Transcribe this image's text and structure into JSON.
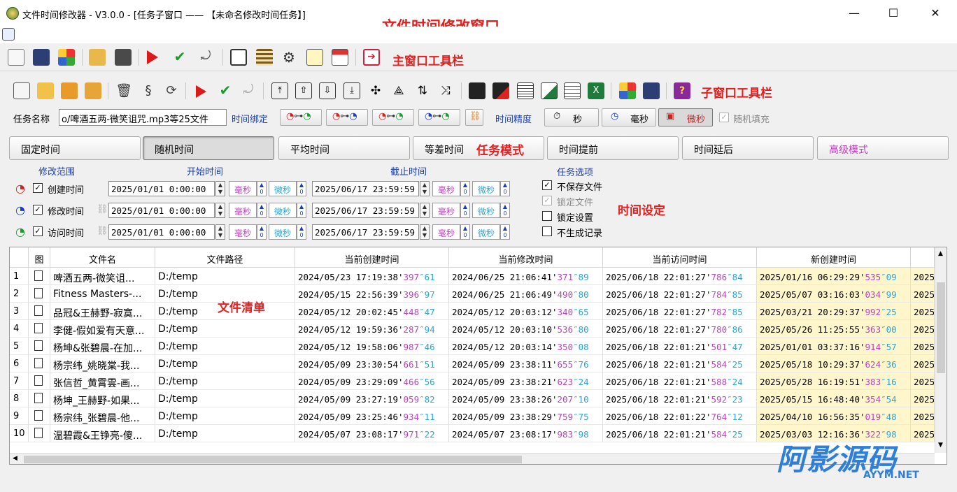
{
  "window": {
    "title": "文件时间修改器  - V3.0.0 - [任务子窗口 —— 【未命名修改时间任务】]",
    "minimize": "—",
    "maximize": "☐",
    "close": "✕"
  },
  "annotations": {
    "window": "文件时间修改窗口",
    "main_toolbar": "主窗口工具栏",
    "sub_toolbar": "子窗口工具栏",
    "task_mode": "任务模式",
    "time_setting": "时间设定",
    "file_list": "文件清单"
  },
  "task": {
    "name_label": "任务名称",
    "name_value": "o/啤酒五两-微笑诅咒.mp3等25文件",
    "bind_label": "时间绑定",
    "precision_label": "时间精度",
    "precision_options": [
      "秒",
      "毫秒",
      "微秒"
    ],
    "random_fill": "随机填充"
  },
  "modes": [
    "固定时间",
    "随机时间",
    "平均时间",
    "等差时间",
    "时间提前",
    "时间延后",
    "高级模式"
  ],
  "time_settings": {
    "range_label": "修改范围",
    "start_label": "开始时间",
    "end_label": "截止时间",
    "ms_label": "毫秒",
    "us_label": "微秒",
    "zero": "0",
    "rows": [
      {
        "label": "创建时间",
        "start": "2025/01/01  0:00:00",
        "end": "2025/06/17  23:59:59"
      },
      {
        "label": "修改时间",
        "start": "2025/01/01  0:00:00",
        "end": "2025/06/17  23:59:59"
      },
      {
        "label": "访问时间",
        "start": "2025/01/01  0:00:00",
        "end": "2025/06/17  23:59:59"
      }
    ],
    "options_label": "任务选项",
    "options": [
      {
        "label": "不保存文件",
        "checked": true
      },
      {
        "label": "锁定文件",
        "checked": true
      },
      {
        "label": "锁定设置",
        "checked": false
      },
      {
        "label": "不生成记录",
        "checked": false
      }
    ]
  },
  "grid": {
    "columns": [
      "图",
      "文件名",
      "文件路径",
      "当前创建时间",
      "当前修改时间",
      "当前访问时间",
      "新创建时间"
    ],
    "rows": [
      {
        "n": "1",
        "name": "啤酒五两-微笑诅...",
        "path": "D:/temp",
        "c": [
          "2024/05/23 17:19:38'",
          "397",
          "″61"
        ],
        "m": [
          "2024/06/25 21:06:41'",
          "371",
          "″89"
        ],
        "a": [
          "2025/06/18 22:01:27'",
          "786",
          "″84"
        ],
        "nc": [
          "2025/01/16 06:29:29'",
          "535",
          "″09"
        ]
      },
      {
        "n": "2",
        "name": "Fitness Masters-...",
        "path": "D:/temp",
        "c": [
          "2024/05/15 22:56:39'",
          "396",
          "″97"
        ],
        "m": [
          "2024/06/25 21:06:49'",
          "490",
          "″80"
        ],
        "a": [
          "2025/06/18 22:01:27'",
          "784",
          "″85"
        ],
        "nc": [
          "2025/05/07 03:16:03'",
          "034",
          "″99"
        ]
      },
      {
        "n": "3",
        "name": "品冠&王赫野-寂寞...",
        "path": "D:/temp",
        "c": [
          "2024/05/12 20:02:45'",
          "448",
          "″47"
        ],
        "m": [
          "2024/05/12 20:03:12'",
          "340",
          "″65"
        ],
        "a": [
          "2025/06/18 22:01:27'",
          "782",
          "″85"
        ],
        "nc": [
          "2025/03/21 20:29:37'",
          "992",
          "″25"
        ]
      },
      {
        "n": "4",
        "name": "李健-假如爱有天意...",
        "path": "D:/temp",
        "c": [
          "2024/05/12 19:59:36'",
          "287",
          "″94"
        ],
        "m": [
          "2024/05/12 20:03:10'",
          "536",
          "″80"
        ],
        "a": [
          "2025/06/18 22:01:27'",
          "780",
          "″86"
        ],
        "nc": [
          "2025/05/26 11:25:55'",
          "363",
          "″00"
        ]
      },
      {
        "n": "5",
        "name": "杨坤&张碧晨-在加...",
        "path": "D:/temp",
        "c": [
          "2024/05/12 19:58:06'",
          "987",
          "″46"
        ],
        "m": [
          "2024/05/12 20:03:14'",
          "350",
          "″08"
        ],
        "a": [
          "2025/06/18 22:01:21'",
          "501",
          "″47"
        ],
        "nc": [
          "2025/01/01 03:37:16'",
          "914",
          "″57"
        ]
      },
      {
        "n": "6",
        "name": "杨宗纬_姚晓棠-我...",
        "path": "D:/temp",
        "c": [
          "2024/05/09 23:30:54'",
          "661",
          "″51"
        ],
        "m": [
          "2024/05/09 23:38:11'",
          "655",
          "″76"
        ],
        "a": [
          "2025/06/18 22:01:21'",
          "584",
          "″25"
        ],
        "nc": [
          "2025/05/18 10:29:37'",
          "624",
          "″36"
        ]
      },
      {
        "n": "7",
        "name": "张信哲_黄霄雲-画...",
        "path": "D:/temp",
        "c": [
          "2024/05/09 23:29:09'",
          "466",
          "″56"
        ],
        "m": [
          "2024/05/09 23:38:21'",
          "623",
          "″24"
        ],
        "a": [
          "2025/06/18 22:01:21'",
          "588",
          "″24"
        ],
        "nc": [
          "2025/05/28 16:19:51'",
          "383",
          "″16"
        ]
      },
      {
        "n": "8",
        "name": "杨坤_王赫野-如果...",
        "path": "D:/temp",
        "c": [
          "2024/05/09 23:27:19'",
          "059",
          "″82"
        ],
        "m": [
          "2024/05/09 23:38:26'",
          "207",
          "″10"
        ],
        "a": [
          "2025/06/18 22:01:21'",
          "592",
          "″23"
        ],
        "nc": [
          "2025/05/15 16:48:40'",
          "354",
          "″54"
        ]
      },
      {
        "n": "9",
        "name": "杨宗纬_张碧晨-他...",
        "path": "D:/temp",
        "c": [
          "2024/05/09 23:25:46'",
          "934",
          "″11"
        ],
        "m": [
          "2024/05/09 23:38:29'",
          "759",
          "″75"
        ],
        "a": [
          "2025/06/18 22:01:22'",
          "764",
          "″12"
        ],
        "nc": [
          "2025/04/10 16:56:35'",
          "019",
          "″48"
        ]
      },
      {
        "n": "10",
        "name": "温碧霞&王铮亮-傻...",
        "path": "D:/temp",
        "c": [
          "2024/05/07 23:08:17'",
          "971",
          "″22"
        ],
        "m": [
          "2024/05/07 23:08:17'",
          "983",
          "″98"
        ],
        "a": [
          "2025/06/18 22:01:21'",
          "584",
          "″25"
        ],
        "nc": [
          "2025/03/03 12:16:36'",
          "322",
          "″98"
        ]
      }
    ],
    "overflow_col": "2025"
  },
  "watermark": {
    "main": "阿影源码",
    "sub": "AYYM.NET"
  },
  "colors": {
    "annotation": "#e61e1e",
    "label_blue": "#1b3fae",
    "ms": "#c040c0",
    "us": "#2aa5d8",
    "new_col": "#fff6cc"
  }
}
